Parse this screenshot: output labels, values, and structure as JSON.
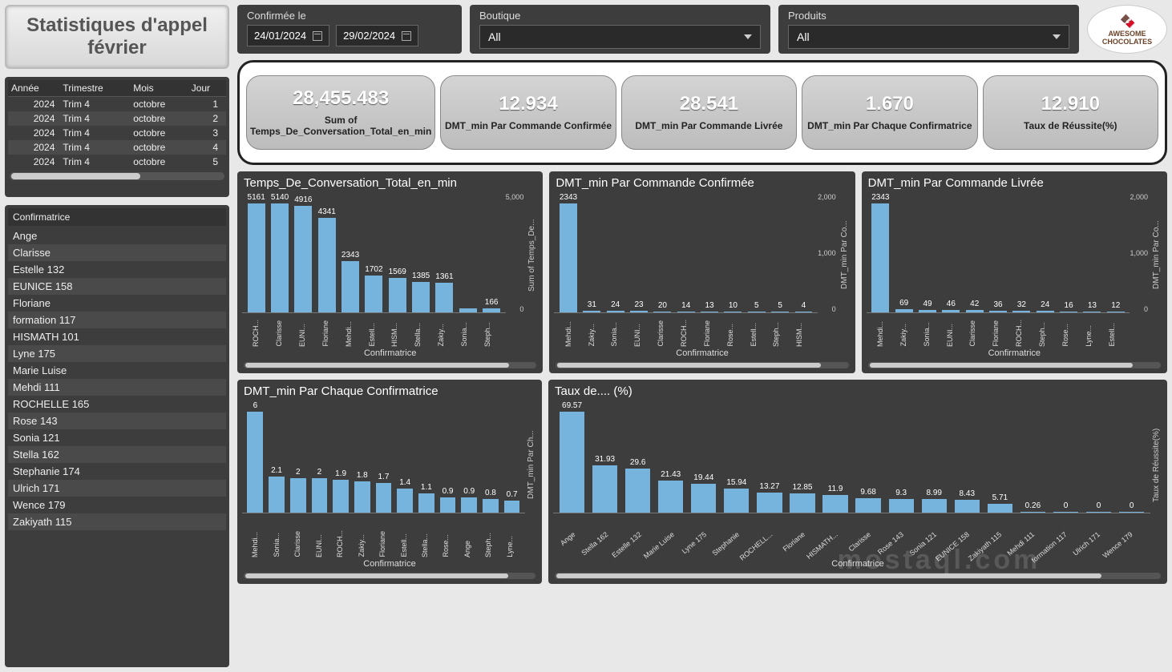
{
  "title": "Statistiques d'appel février",
  "filters": {
    "date_label": "Confirmée le",
    "date_start": "24/01/2024",
    "date_end": "29/02/2024",
    "boutique_label": "Boutique",
    "boutique_value": "All",
    "produits_label": "Produits",
    "produits_value": "All"
  },
  "logo": {
    "brand_top": "AWESOME",
    "brand_bottom": "CHOCOLATES"
  },
  "date_table": {
    "headers": [
      "Année",
      "Trimestre",
      "Mois",
      "Jour"
    ],
    "rows": [
      [
        "2024",
        "Trim 4",
        "octobre",
        "1"
      ],
      [
        "2024",
        "Trim 4",
        "octobre",
        "2"
      ],
      [
        "2024",
        "Trim 4",
        "octobre",
        "3"
      ],
      [
        "2024",
        "Trim 4",
        "octobre",
        "4"
      ],
      [
        "2024",
        "Trim 4",
        "octobre",
        "5"
      ]
    ]
  },
  "confirmatrice_slicer": {
    "header": "Confirmatrice",
    "items": [
      "Ange",
      "Clarisse",
      "Estelle 132",
      "EUNICE 158",
      "Floriane",
      "formation 117",
      "HISMATH 101",
      "Lyne 175",
      "Marie Luise",
      "Mehdi 111",
      "ROCHELLE 165",
      "Rose 143",
      "Sonia 121",
      "Stella 162",
      "Stephanie 174",
      "Ulrich 171",
      "Wence 179",
      "Zakiyath 115"
    ]
  },
  "kpis": [
    {
      "value": "28,455.483",
      "label": "Sum of Temps_De_Conversation_Total_en_min"
    },
    {
      "value": "12.934",
      "label": "DMT_min Par Commande Confirmée"
    },
    {
      "value": "28.541",
      "label": "DMT_min Par Commande Livrée"
    },
    {
      "value": "1.670",
      "label": "DMT_min Par Chaque Confirmatrice"
    },
    {
      "value": "12.910",
      "label": "Taux de Réussite(%)"
    }
  ],
  "chart_data": [
    {
      "id": "c1",
      "type": "bar",
      "title": "Temps_De_Conversation_Total_en_min",
      "xlabel": "Confirmatrice",
      "ylabel": "Sum of Temps_De...",
      "ylim": [
        0,
        5500
      ],
      "yticks": [
        "5,000",
        "0"
      ],
      "categories": [
        "ROCH...",
        "Clarisse",
        "EUNI...",
        "Floriane",
        "Mehdi...",
        "Estell...",
        "HISM...",
        "Stella...",
        "Zakiy...",
        "Sonia...",
        "Steph..."
      ],
      "values": [
        5161,
        5140,
        4916,
        4341,
        2343,
        1702,
        1569,
        1385,
        1361,
        null,
        166
      ]
    },
    {
      "id": "c2",
      "type": "bar",
      "title": "DMT_min Par Commande Confirmée",
      "xlabel": "Confirmatrice",
      "ylabel": "DMT_min Par Co...",
      "ylim": [
        0,
        2500
      ],
      "yticks": [
        "2,000",
        "1,000",
        "0"
      ],
      "categories": [
        "Mehdi...",
        "Zakiy...",
        "Sonia...",
        "EUNI...",
        "Clarisse",
        "ROCH...",
        "Floriane",
        "Rose...",
        "Estell...",
        "Steph...",
        "HISM..."
      ],
      "values": [
        2343,
        31,
        24,
        23,
        20,
        14,
        13,
        10,
        5,
        5,
        4
      ]
    },
    {
      "id": "c3",
      "type": "bar",
      "title": "DMT_min Par Commande Livrée",
      "xlabel": "Confirmatrice",
      "ylabel": "DMT_min Par Co...",
      "ylim": [
        0,
        2500
      ],
      "yticks": [
        "2,000",
        "1,000",
        "0"
      ],
      "categories": [
        "Mehdi...",
        "Zakiy...",
        "Sonia...",
        "EUNI...",
        "Clarisse",
        "Floriane",
        "ROCH...",
        "Steph...",
        "Rose...",
        "Lyne...",
        "Estell..."
      ],
      "values": [
        2343,
        69,
        49,
        46,
        42,
        36,
        32,
        24,
        16,
        13,
        12
      ]
    },
    {
      "id": "c4",
      "type": "bar",
      "title": "DMT_min Par Chaque Confirmatrice",
      "xlabel": "Confirmatrice",
      "ylabel": "DMT_min Par Ch...",
      "ylim": [
        0,
        6.5
      ],
      "yticks": [],
      "categories": [
        "Mehdi...",
        "Sonia...",
        "Clarisse",
        "EUNI...",
        "ROCH...",
        "Zakiy...",
        "Floriane",
        "Estell...",
        "Stella...",
        "Rose...",
        "Ange",
        "Steph...",
        "Lyne..."
      ],
      "values": [
        6.0,
        2.1,
        2.0,
        2.0,
        1.9,
        1.8,
        1.7,
        1.4,
        1.1,
        0.9,
        0.9,
        0.8,
        0.7
      ]
    },
    {
      "id": "c5",
      "type": "bar",
      "title": "Taux de.... (%)",
      "xlabel": "Confirmatrice",
      "ylabel": "Taux de Réussite(%)",
      "ylim": [
        0,
        75
      ],
      "yticks": [],
      "categories": [
        "Ange",
        "Stella 162",
        "Estelle 132",
        "Marie Luise",
        "Lyne 175",
        "Stephanie",
        "ROCHELL...",
        "Floriane",
        "HISMATH...",
        "Clarisse",
        "Rose 143",
        "Sonia 121",
        "EUNICE 158",
        "Zakiyath 115",
        "Mehdi 111",
        "formation 117",
        "Ulrich 171",
        "Wence 179"
      ],
      "values": [
        69.57,
        31.93,
        29.6,
        21.43,
        19.44,
        15.94,
        13.27,
        12.85,
        11.9,
        9.68,
        9.3,
        8.99,
        8.43,
        5.71,
        0.26,
        0.0,
        0.0,
        0.0
      ]
    }
  ],
  "watermark": "mostaql.com"
}
